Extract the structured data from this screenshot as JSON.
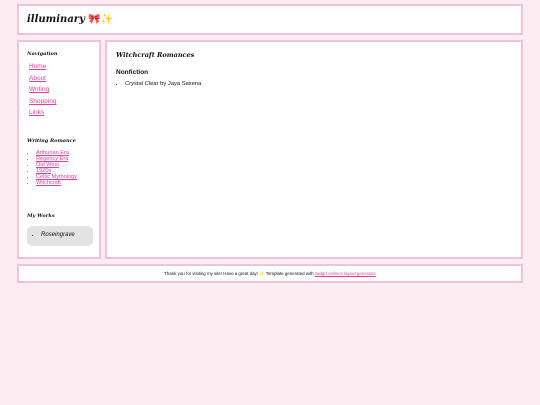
{
  "header": {
    "title": "illuminary",
    "title_emoji": "🎀✨"
  },
  "sidebar": {
    "nav_heading": "Navigation",
    "nav_links": [
      "Home",
      "About",
      "Writing",
      "Shopping",
      "Links"
    ],
    "romance_heading": "Writing Romance",
    "romance_links": [
      "Arthurian Era",
      "Regency Era",
      "Old West",
      "1920s",
      "Celtic Mythology",
      "Witchcraft"
    ],
    "works_heading": "My Works",
    "works_items": [
      "Roseingrave"
    ]
  },
  "main": {
    "title": "Witchcraft Romances",
    "section_heading": "Nonfiction",
    "items": [
      {
        "book": "Crystal Clear",
        "by": " by Jaya Saxena"
      }
    ]
  },
  "footer": {
    "text": "Thank you for visiting my site! Have a great day! ✨ Template generated with ",
    "link": "sadgrl.online's layout generator"
  },
  "colors": {
    "background": "#fdedf2",
    "border": "#f0c4d8",
    "link": "#e23e9a"
  }
}
